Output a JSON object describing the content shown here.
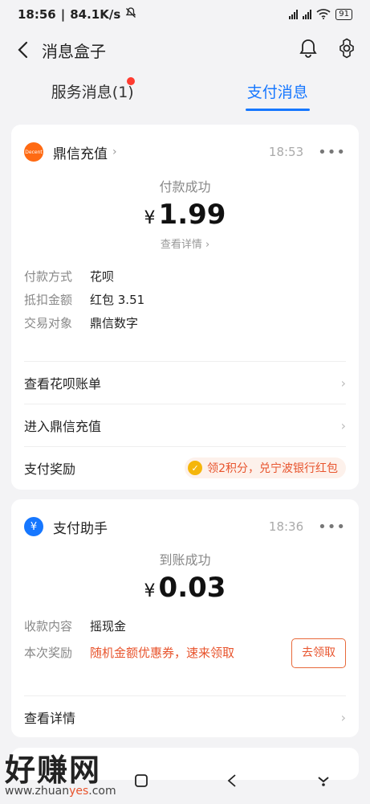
{
  "status_bar": {
    "time": "18:56",
    "speed": "84.1K/s",
    "battery": "91"
  },
  "header": {
    "title": "消息盒子"
  },
  "tabs": [
    {
      "label": "服务消息(1)",
      "has_dot": true
    },
    {
      "label": "支付消息",
      "active": true
    }
  ],
  "card1": {
    "merchant": "鼎信充值",
    "logo_text": "Decent",
    "time": "18:53",
    "status": "付款成功",
    "currency": "¥",
    "amount": "1.99",
    "detail_link": "查看详情",
    "fields": [
      {
        "key": "付款方式",
        "value": "花呗"
      },
      {
        "key": "抵扣金额",
        "value": "红包 3.51"
      },
      {
        "key": "交易对象",
        "value": "鼎信数字"
      }
    ],
    "rows": [
      {
        "label": "查看花呗账单"
      },
      {
        "label": "进入鼎信充值"
      }
    ],
    "reward_label": "支付奖励",
    "reward_text": "领2积分，兑宁波银行红包"
  },
  "card2": {
    "merchant": "支付助手",
    "time": "18:36",
    "status": "到账成功",
    "currency": "¥",
    "amount": "0.03",
    "fields": [
      {
        "key": "收款内容",
        "value": "摇现金"
      }
    ],
    "bonus_key": "本次奖励",
    "bonus_value": "随机金额优惠券，速来领取",
    "claim_button": "去领取",
    "detail_row": "查看详情"
  },
  "watermark": {
    "big": "好赚网",
    "small_pre": "www.zhuan",
    "small_mid": "yes",
    "small_post": ".com"
  },
  "colors": {
    "accent": "#1677ff",
    "reward": "#e8542d"
  }
}
